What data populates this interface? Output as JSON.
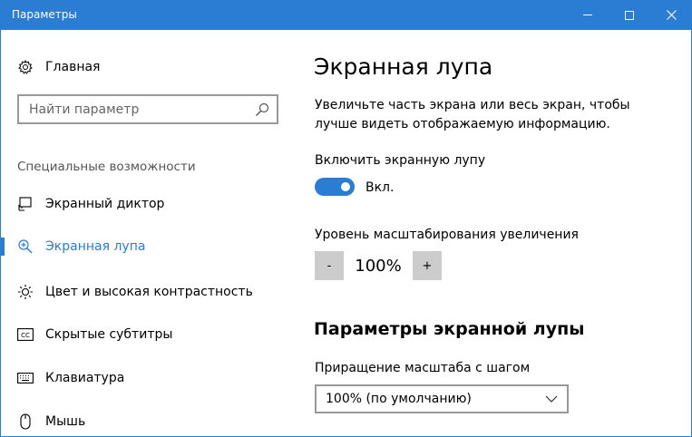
{
  "window": {
    "title": "Параметры"
  },
  "sidebar": {
    "home_label": "Главная",
    "search_placeholder": "Найти параметр",
    "category": "Специальные возможности",
    "items": [
      {
        "label": "Экранный диктор",
        "icon": "narrator-icon"
      },
      {
        "label": "Экранная лупа",
        "icon": "magnifier-icon",
        "selected": true
      },
      {
        "label": "Цвет и высокая контрастность",
        "icon": "brightness-icon"
      },
      {
        "label": "Скрытые субтитры",
        "icon": "closed-captions-icon"
      },
      {
        "label": "Клавиатура",
        "icon": "keyboard-icon"
      },
      {
        "label": "Мышь",
        "icon": "mouse-icon"
      }
    ]
  },
  "main": {
    "title": "Экранная лупа",
    "description": "Увеличьте часть экрана или весь экран, чтобы лучше видеть отображаемую информацию.",
    "toggle_heading": "Включить экранную лупу",
    "toggle_state": "Вкл.",
    "zoom_heading": "Уровень масштабирования увеличения",
    "zoom_minus": "-",
    "zoom_value": "100%",
    "zoom_plus": "+",
    "section_title": "Параметры экранной лупы",
    "step_heading": "Приращение масштаба с шагом",
    "step_value": "100% (по умолчанию)"
  },
  "colors": {
    "accent": "#2b7cd3",
    "button_gray": "#cccccc"
  }
}
